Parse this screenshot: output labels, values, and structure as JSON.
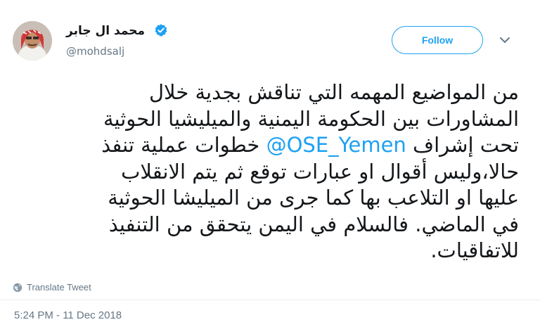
{
  "author": {
    "name": "محمد ال جابر",
    "handle": "@mohdsalj",
    "verified": true
  },
  "follow_button": {
    "label": "Follow"
  },
  "tweet": {
    "lines": [
      "من المواضيع المهمه التي تناقش بجدية خلال",
      "المشاورات بين الحكومة اليمنية والميليشيا الحوثية",
      {
        "before": "تحت إشراف ",
        "mention": "@OSE_Yemen",
        "after": " خطوات عملية تنفذ"
      },
      "حالا،وليس أقوال او عبارات توقع ثم يتم الانقلاب",
      "عليها او التلاعب بها كما جرى من الميليشا الحوثية",
      "في الماضي. فالسلام في اليمن يتحقق من التنفيذ",
      "للاتفاقيات."
    ]
  },
  "translate": {
    "label": "Translate Tweet",
    "icon": "globe-icon"
  },
  "timestamp": "5:24 PM - 11 Dec 2018",
  "colors": {
    "accent": "#1da1f2",
    "secondary_text": "#657786",
    "text": "#14171a"
  }
}
